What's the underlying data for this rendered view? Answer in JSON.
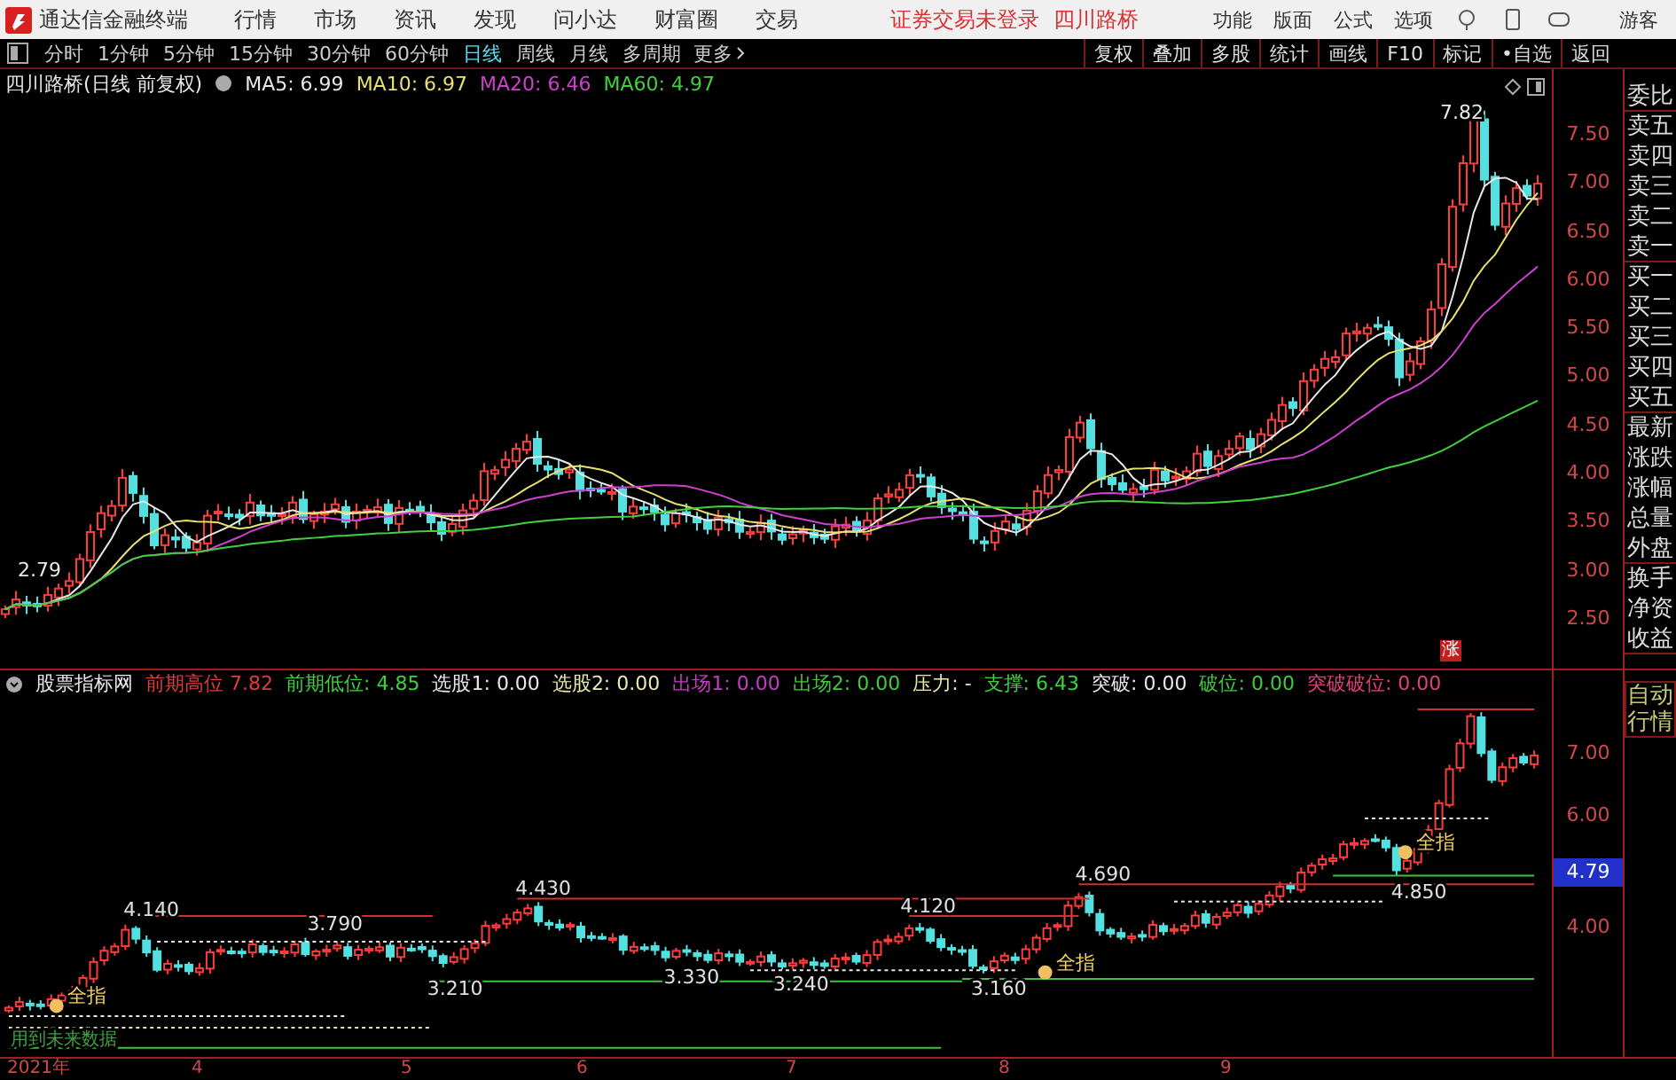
{
  "menu_bar": {
    "app_title": "通达信金融终端",
    "menus": [
      "行情",
      "市场",
      "资讯",
      "发现",
      "问小达",
      "财富圈",
      "交易"
    ],
    "status": "证券交易未登录",
    "stock": "四川路桥",
    "right_menus": [
      "功能",
      "版面",
      "公式",
      "选项"
    ],
    "user": "游客"
  },
  "period_bar": {
    "periods": [
      {
        "label": "分时",
        "selected": false
      },
      {
        "label": "1分钟",
        "selected": false
      },
      {
        "label": "5分钟",
        "selected": false
      },
      {
        "label": "15分钟",
        "selected": false
      },
      {
        "label": "30分钟",
        "selected": false
      },
      {
        "label": "60分钟",
        "selected": false
      },
      {
        "label": "日线",
        "selected": true
      },
      {
        "label": "周线",
        "selected": false
      },
      {
        "label": "月线",
        "selected": false
      },
      {
        "label": "多周期",
        "selected": false
      }
    ],
    "more": "更多",
    "tools": [
      "复权",
      "叠加",
      "多股",
      "统计",
      "画线",
      "F10",
      "标记",
      "•自选",
      "返回"
    ]
  },
  "main_chart": {
    "title": "四川路桥(日线 前复权)",
    "moving_averages": [
      {
        "label": "MA5: 6.99",
        "color": "#e8e8e8"
      },
      {
        "label": "MA10: 6.97",
        "color": "#e8e070"
      },
      {
        "label": "MA20: 6.46",
        "color": "#d040d0"
      },
      {
        "label": "MA60: 4.97",
        "color": "#40d040"
      }
    ],
    "y_ticks": [
      "7.50",
      "7.00",
      "6.50",
      "6.00",
      "5.50",
      "5.00",
      "4.50",
      "4.00",
      "3.50",
      "3.00",
      "2.50"
    ],
    "high_label": "7.82",
    "low_label": "2.79",
    "badge": "涨"
  },
  "indicator": {
    "title": "股票指标网",
    "values": [
      {
        "label": "前期高位",
        "value": "7.82",
        "color": "#e03c3c"
      },
      {
        "label": "前期低位:",
        "value": "4.85",
        "color": "#40d040"
      },
      {
        "label": "选股1:",
        "value": "0.00",
        "color": "#e8e8e8"
      },
      {
        "label": "选股2:",
        "value": "0.00",
        "color": "#e8e8b0"
      },
      {
        "label": "出场1:",
        "value": "0.00",
        "color": "#c040c0"
      },
      {
        "label": "出场2:",
        "value": "0.00",
        "color": "#40c840"
      },
      {
        "label": "压力:",
        "value": "-",
        "color": "#e8e8b0"
      },
      {
        "label": "支撑:",
        "value": "6.43",
        "color": "#40d040"
      },
      {
        "label": "突破:",
        "value": "0.00",
        "color": "#e8e8e8"
      },
      {
        "label": "破位:",
        "value": "0.00",
        "color": "#40c840"
      },
      {
        "label": "突破破位:",
        "value": "0.00",
        "color": "#e0407a"
      }
    ],
    "price_labels": [
      "4.140",
      "3.790",
      "4.430",
      "4.120",
      "4.690",
      "3.210",
      "3.330",
      "3.240",
      "3.160",
      "4.850"
    ],
    "signals": [
      "全指",
      "全指",
      "全指"
    ],
    "future_note": "用到未来数据",
    "y_ticks": [
      {
        "label": "7.00",
        "kind": "tick"
      },
      {
        "label": "6.00",
        "kind": "tick"
      },
      {
        "label": "4.79",
        "kind": "current"
      },
      {
        "label": "4.00",
        "kind": "tick"
      }
    ]
  },
  "quote_panel": {
    "fields": [
      "委比",
      "卖五",
      "卖四",
      "卖三",
      "卖二",
      "卖一",
      "买一",
      "买二",
      "买三",
      "买四",
      "买五",
      "最新",
      "涨跌",
      "涨幅",
      "总量",
      "外盘",
      "换手",
      "净资",
      "收益"
    ],
    "auto_button": "自动行情"
  },
  "date_axis": [
    "2021年",
    "4",
    "5",
    "6",
    "7",
    "8",
    "9"
  ]
}
